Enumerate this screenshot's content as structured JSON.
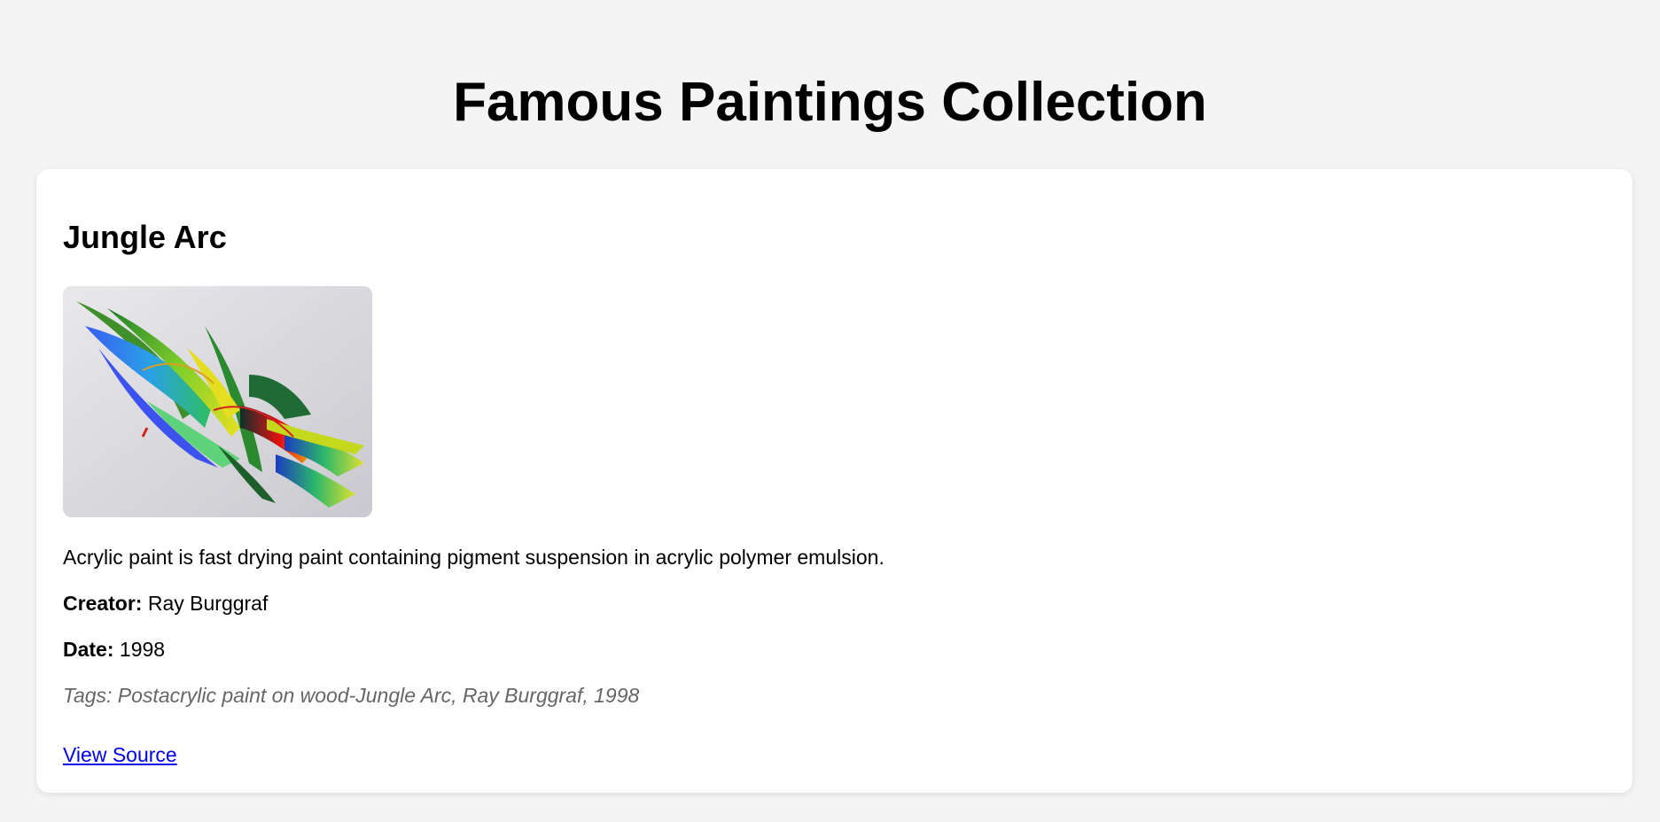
{
  "page": {
    "title": "Famous Paintings Collection"
  },
  "painting": {
    "title": "Jungle Arc",
    "image_alt": "Jungle Arc",
    "description": "Acrylic paint is fast drying paint containing pigment suspension in acrylic polymer emulsion.",
    "creator_label": "Creator:",
    "creator": "Ray Burggraf",
    "date_label": "Date:",
    "date": "1998",
    "tags": "Tags: Postacrylic paint on wood-Jungle Arc, Ray Burggraf, 1998",
    "source_link": "View Source"
  },
  "colors": {
    "background": "#f4f4f4",
    "card": "#ffffff",
    "link": "#0000ee",
    "tags_text": "#666666"
  }
}
